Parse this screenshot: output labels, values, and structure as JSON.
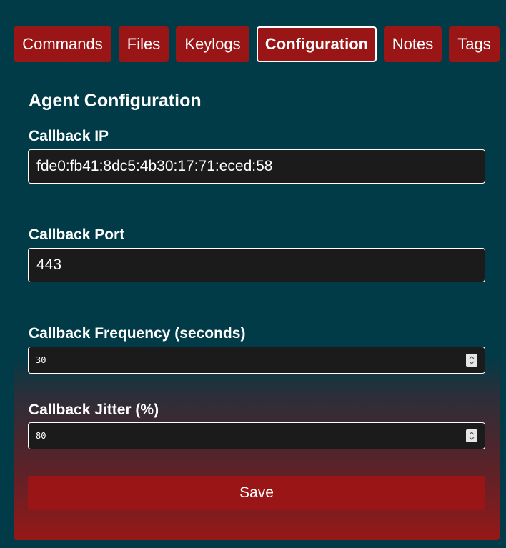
{
  "tabs": [
    {
      "label": "Commands",
      "active": false
    },
    {
      "label": "Files",
      "active": false
    },
    {
      "label": "Keylogs",
      "active": false
    },
    {
      "label": "Configuration",
      "active": true
    },
    {
      "label": "Notes",
      "active": false
    },
    {
      "label": "Tags",
      "active": false
    }
  ],
  "config": {
    "title": "Agent Configuration",
    "callback_ip": {
      "label": "Callback IP",
      "value": "fde0:fb41:8dc5:4b30:17:71:eced:58"
    },
    "callback_port": {
      "label": "Callback Port",
      "value": "443"
    },
    "callback_frequency": {
      "label": "Callback Frequency (seconds)",
      "value": "30"
    },
    "callback_jitter": {
      "label": "Callback Jitter (%)",
      "value": "80"
    },
    "save_label": "Save"
  },
  "colors": {
    "background": "#003b47",
    "accent": "#9a1616",
    "input_bg": "#1b1b1b"
  },
  "icons": {
    "spinner": "up-down-arrows-icon"
  }
}
